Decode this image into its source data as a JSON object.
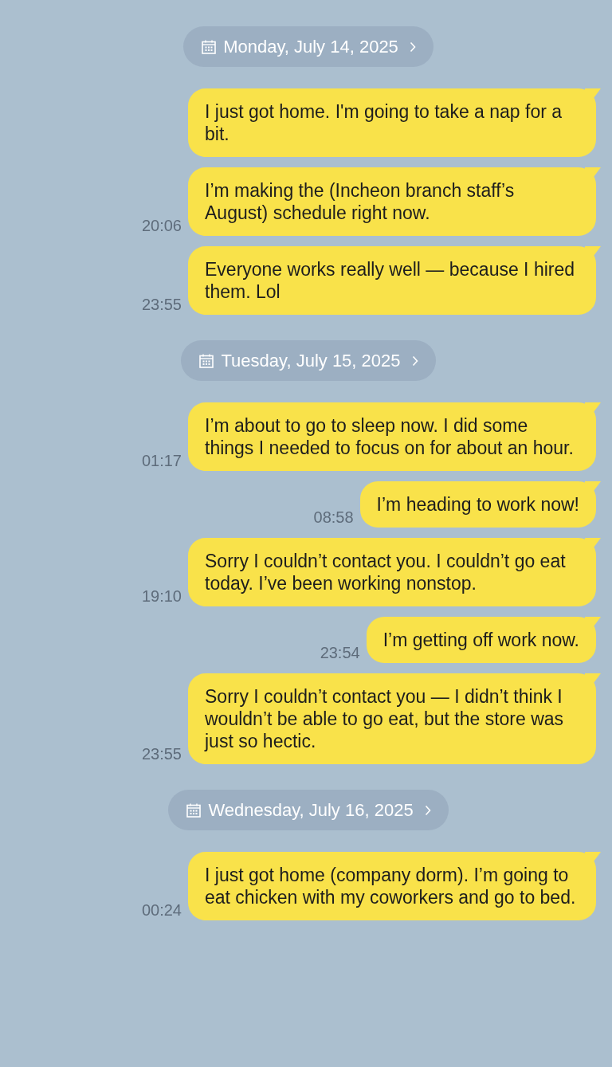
{
  "days": [
    {
      "date": "Monday, July 14, 2025",
      "messages": [
        {
          "text": "I just got home. I'm going to take a nap for a bit."
        },
        {
          "text": "I’m making the (Incheon branch staff’s August) schedule right now.",
          "time": "20:06"
        },
        {
          "text": "Everyone works really well — because I hired them. Lol",
          "time": "23:55"
        }
      ]
    },
    {
      "date": "Tuesday, July 15, 2025",
      "messages": [
        {
          "text": "I’m about to go to sleep now. I did some things I needed to focus on for about an hour.",
          "time": "01:17"
        },
        {
          "text": "I’m heading to work now!",
          "time": "08:58"
        },
        {
          "text": "Sorry I couldn’t contact you. I couldn’t go eat today. I’ve been working nonstop.",
          "time": "19:10"
        },
        {
          "text": "I’m getting off work now.",
          "time": "23:54"
        },
        {
          "text": "Sorry I couldn’t contact you — I didn’t think I wouldn’t be able to go eat, but the store was just so hectic.",
          "time": "23:55"
        }
      ]
    },
    {
      "date": "Wednesday, July 16, 2025",
      "messages": [
        {
          "text": "I just got home (company dorm). I’m going to eat chicken with my coworkers and go to bed.",
          "time": "00:24"
        }
      ]
    }
  ]
}
